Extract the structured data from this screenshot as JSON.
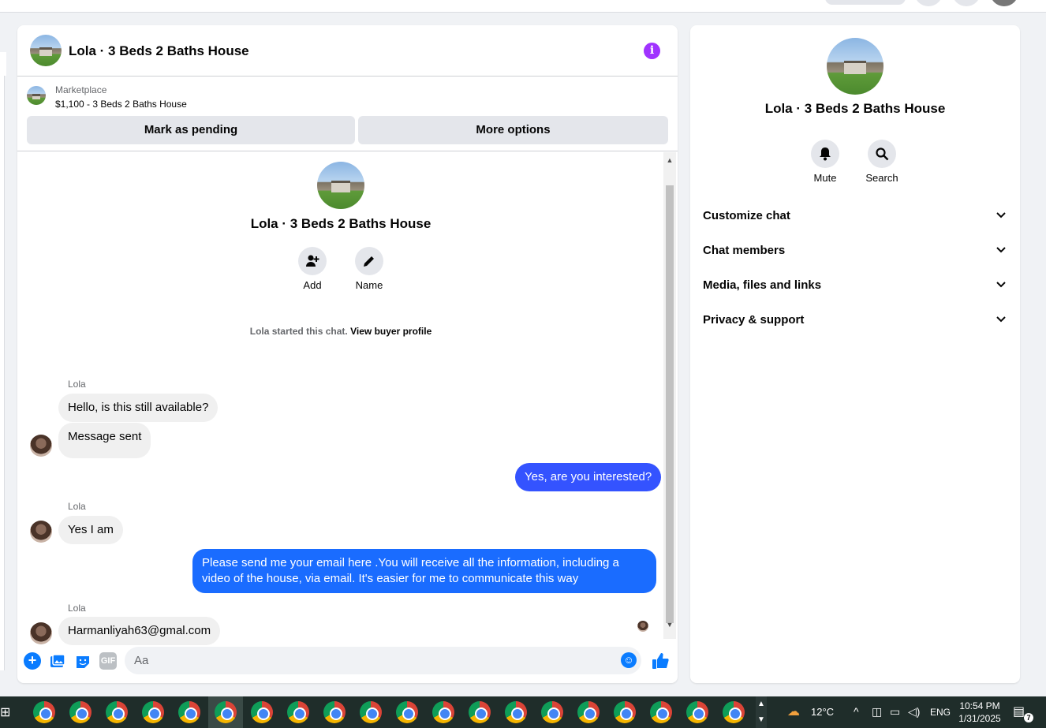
{
  "chat": {
    "title": "Lola · 3 Beds 2 Baths House",
    "marketplace_label": "Marketplace",
    "listing": "$1,100 - 3 Beds 2 Baths House",
    "mark_pending": "Mark as pending",
    "more_options": "More options",
    "conv_name": "Lola · 3 Beds 2 Baths House",
    "actions": {
      "add": "Add",
      "name": "Name"
    },
    "started_text": "Lola started this chat.",
    "buyer_profile_link": "View buyer profile",
    "messages": [
      {
        "sender": "Lola",
        "text": "Hello, is this still available?"
      },
      {
        "text": "Message sent"
      },
      {
        "text": "Yes, are you interested?"
      },
      {
        "sender": "Lola",
        "text": "Yes I am"
      },
      {
        "text": "Please send me your email here .You will receive all the information, including a video of the house, via email. It's easier for me to communicate this way"
      },
      {
        "sender": "Lola",
        "text": "Harmanliyah63@gmal.com"
      }
    ],
    "composer": {
      "placeholder": "Aa",
      "gif_label": "GIF"
    }
  },
  "side": {
    "name": "Lola · 3 Beds 2 Baths House",
    "mute": "Mute",
    "search": "Search",
    "sections": [
      "Customize chat",
      "Chat members",
      "Media, files and links",
      "Privacy & support"
    ]
  },
  "taskbar": {
    "temperature": "12°C",
    "language": "ENG",
    "time": "10:54 PM",
    "date": "1/31/2025",
    "notifications": "7"
  },
  "colors": {
    "accent": "#0a7cff",
    "outgoing_bubble": "#3453ff",
    "info": "#a033ff"
  }
}
